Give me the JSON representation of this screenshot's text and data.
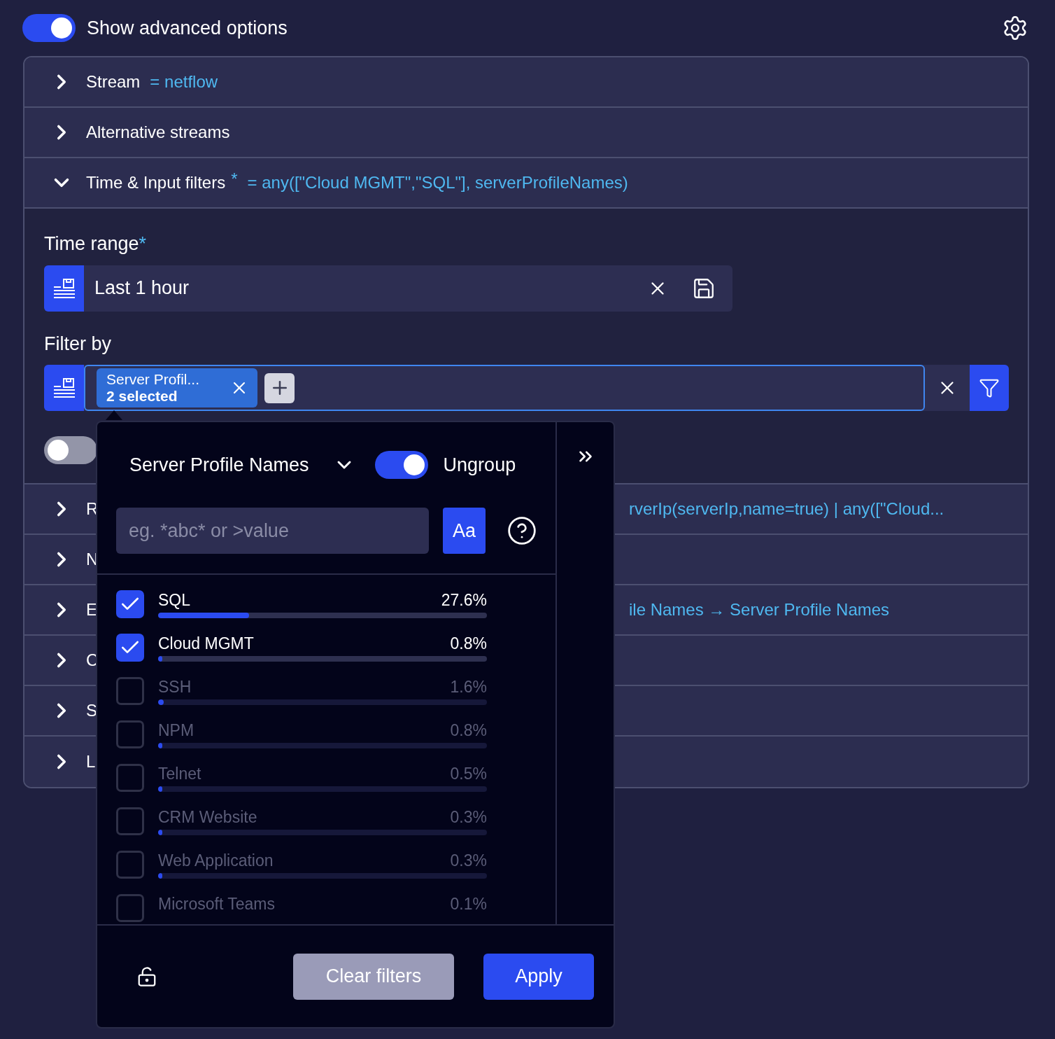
{
  "advanced_toggle": {
    "label": "Show advanced options",
    "on": true
  },
  "sections": [
    {
      "label": "Stream",
      "value": "= netflow",
      "expanded": false
    },
    {
      "label": "Alternative streams",
      "expanded": false
    },
    {
      "label": "Time & Input filters",
      "required_mark": "*",
      "value": "= any([\"Cloud MGMT\",\"SQL\"], serverProfileNames)",
      "expanded": true
    }
  ],
  "time_range": {
    "label": "Time range",
    "required_mark": "*",
    "value": "Last 1 hour"
  },
  "filter_by": {
    "label": "Filter by",
    "chip": {
      "name": "Server Profil...",
      "count": "2 selected"
    }
  },
  "extra_toggle": {
    "on": false
  },
  "collapsed_sections": [
    {
      "label": "R",
      "value": "rverIp(serverIp,name=true) | any([\"Cloud...",
      "expanded": false
    },
    {
      "label": "N",
      "expanded": false
    },
    {
      "label": "E",
      "value": "ile Names → Server Profile Names",
      "expanded": false
    },
    {
      "label": "C",
      "expanded": false
    },
    {
      "label": "S",
      "expanded": false
    },
    {
      "label": "L",
      "expanded": false
    }
  ],
  "popover": {
    "field": "Server Profile Names",
    "ungroup": {
      "label": "Ungroup",
      "on": true
    },
    "search": {
      "placeholder": "eg. *abc* or >value"
    },
    "case_button": "Aa",
    "options": [
      {
        "label": "SQL",
        "percent": "27.6%",
        "level": 0.276,
        "checked": true
      },
      {
        "label": "Cloud MGMT",
        "percent": "0.8%",
        "level": 0.008,
        "checked": true
      },
      {
        "label": "SSH",
        "percent": "1.6%",
        "level": 0.016,
        "checked": false
      },
      {
        "label": "NPM",
        "percent": "0.8%",
        "level": 0.008,
        "checked": false
      },
      {
        "label": "Telnet",
        "percent": "0.5%",
        "level": 0.005,
        "checked": false
      },
      {
        "label": "CRM Website",
        "percent": "0.3%",
        "level": 0.003,
        "checked": false
      },
      {
        "label": "Web Application",
        "percent": "0.3%",
        "level": 0.003,
        "checked": false
      },
      {
        "label": "Microsoft Teams",
        "percent": "0.1%",
        "checked": false
      }
    ],
    "clear_button": "Clear filters",
    "apply_button": "Apply"
  }
}
